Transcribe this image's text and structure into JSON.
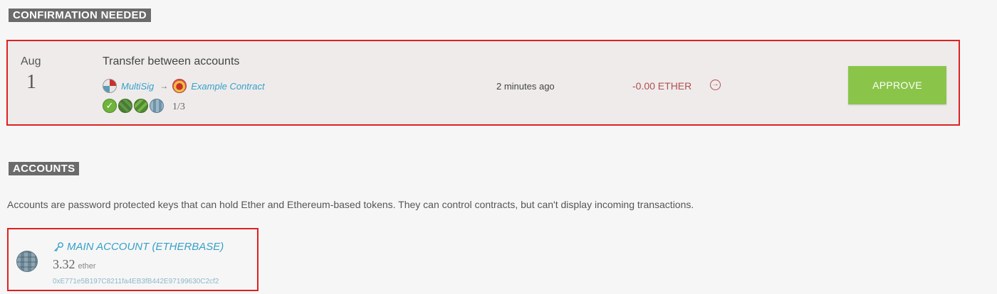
{
  "confirmation": {
    "heading": "CONFIRMATION NEEDED",
    "transaction": {
      "month": "Aug",
      "day": "1",
      "title": "Transfer between accounts",
      "from": "MultiSig",
      "to": "Example Contract",
      "arrow": "→",
      "confirmations": "1/3",
      "time": "2 minutes ago",
      "amount": "-0.00 ETHER",
      "approve_label": "APPROVE",
      "detail_icon": "arrow-circle-right-icon"
    }
  },
  "accounts": {
    "heading": "ACCOUNTS",
    "description": "Accounts are password protected keys that can hold Ether and Ethereum-based tokens. They can control contracts, but can't display incoming transactions.",
    "main": {
      "name": "MAIN ACCOUNT (ETHERBASE)",
      "balance": "3.32",
      "unit": "ether",
      "address": "0xE771e5B197C8211fa4EB3fB442E97199630C2cf2"
    }
  },
  "colors": {
    "approve": "#8ac54a",
    "link": "#35a1c8",
    "highlight_border": "#e02020",
    "amount": "#b05050"
  }
}
